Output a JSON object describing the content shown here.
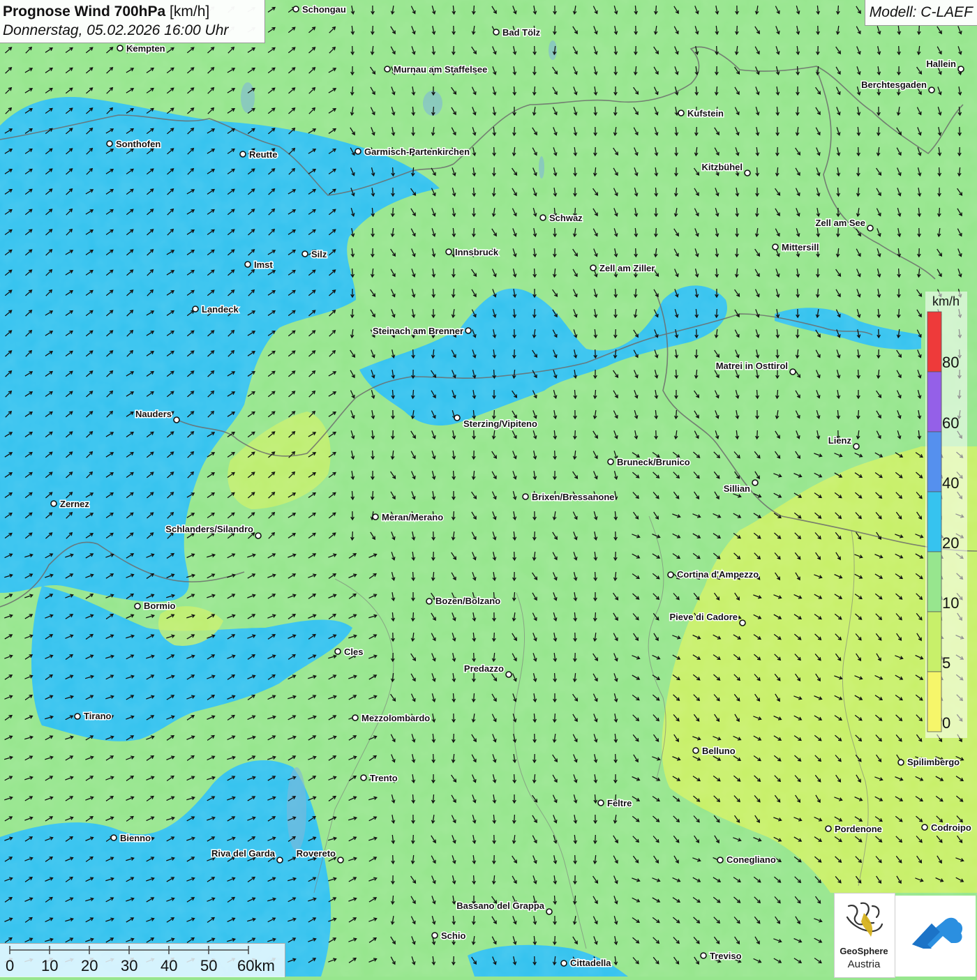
{
  "header": {
    "title_bold": "Prognose Wind 700hPa",
    "title_unit": "[km/h]",
    "subtitle": "Donnerstag, 05.02.2026 16:00 Uhr",
    "model": "Modell: C-LAEF"
  },
  "legend": {
    "unit": "km/h",
    "labels": [
      "0",
      "5",
      "10",
      "20",
      "40",
      "60",
      "80"
    ],
    "colors": [
      "#f6f66a",
      "#c8f06a",
      "#97e68e",
      "#36c3ef",
      "#5590ee",
      "#9460e8",
      "#ee3a3a"
    ]
  },
  "scale_bar": {
    "labels": [
      "0",
      "10",
      "20",
      "30",
      "40",
      "50",
      "60km"
    ]
  },
  "logos": {
    "geosphere_line1": "GeoSphere",
    "geosphere_line2": "Austria",
    "left_icon": "geosphere-logo-icon",
    "right_icon": "cloud-arrow-logo-icon"
  },
  "map": {
    "background_color": "#97e68e",
    "cities": [
      {
        "name": "Schongau"
      },
      {
        "name": "Bad Tölz"
      },
      {
        "name": "Kempten"
      },
      {
        "name": "Murnau am Staffelsee"
      },
      {
        "name": "Hallein"
      },
      {
        "name": "Berchtesgaden"
      },
      {
        "name": "Kufstein"
      },
      {
        "name": "Sonthofen"
      },
      {
        "name": "Reutte"
      },
      {
        "name": "Garmisch-Partenkirchen"
      },
      {
        "name": "Kitzbühel"
      },
      {
        "name": "Schwaz"
      },
      {
        "name": "Zell am See"
      },
      {
        "name": "Mittersill"
      },
      {
        "name": "Innsbruck"
      },
      {
        "name": "Silz"
      },
      {
        "name": "Imst"
      },
      {
        "name": "Zell am Ziller"
      },
      {
        "name": "Landeck"
      },
      {
        "name": "Steinach am Brenner"
      },
      {
        "name": "Matrei in Osttirol"
      },
      {
        "name": "Nauders"
      },
      {
        "name": "Sterzing/Vipiteno"
      },
      {
        "name": "Lienz"
      },
      {
        "name": "Bruneck/Brunico"
      },
      {
        "name": "Sillian"
      },
      {
        "name": "Brixen/Bressanone"
      },
      {
        "name": "Zernez"
      },
      {
        "name": "Meran/Merano"
      },
      {
        "name": "Schlanders/Silandro"
      },
      {
        "name": "Cortina d'Ampezzo"
      },
      {
        "name": "Bozen/Bolzano"
      },
      {
        "name": "Bormio"
      },
      {
        "name": "Pieve di Cadore"
      },
      {
        "name": "Cles"
      },
      {
        "name": "Predazzo"
      },
      {
        "name": "Tirano"
      },
      {
        "name": "Mezzolombardo"
      },
      {
        "name": "Belluno"
      },
      {
        "name": "Spilimbergo"
      },
      {
        "name": "Trento"
      },
      {
        "name": "Feltre"
      },
      {
        "name": "Pordenone"
      },
      {
        "name": "Codroipo"
      },
      {
        "name": "Bienno"
      },
      {
        "name": "Riva del Garda"
      },
      {
        "name": "Rovereto"
      },
      {
        "name": "Conegliano"
      },
      {
        "name": "Bassano del Grappa"
      },
      {
        "name": "Schio"
      },
      {
        "name": "Treviso"
      },
      {
        "name": "Cittadella"
      }
    ]
  }
}
